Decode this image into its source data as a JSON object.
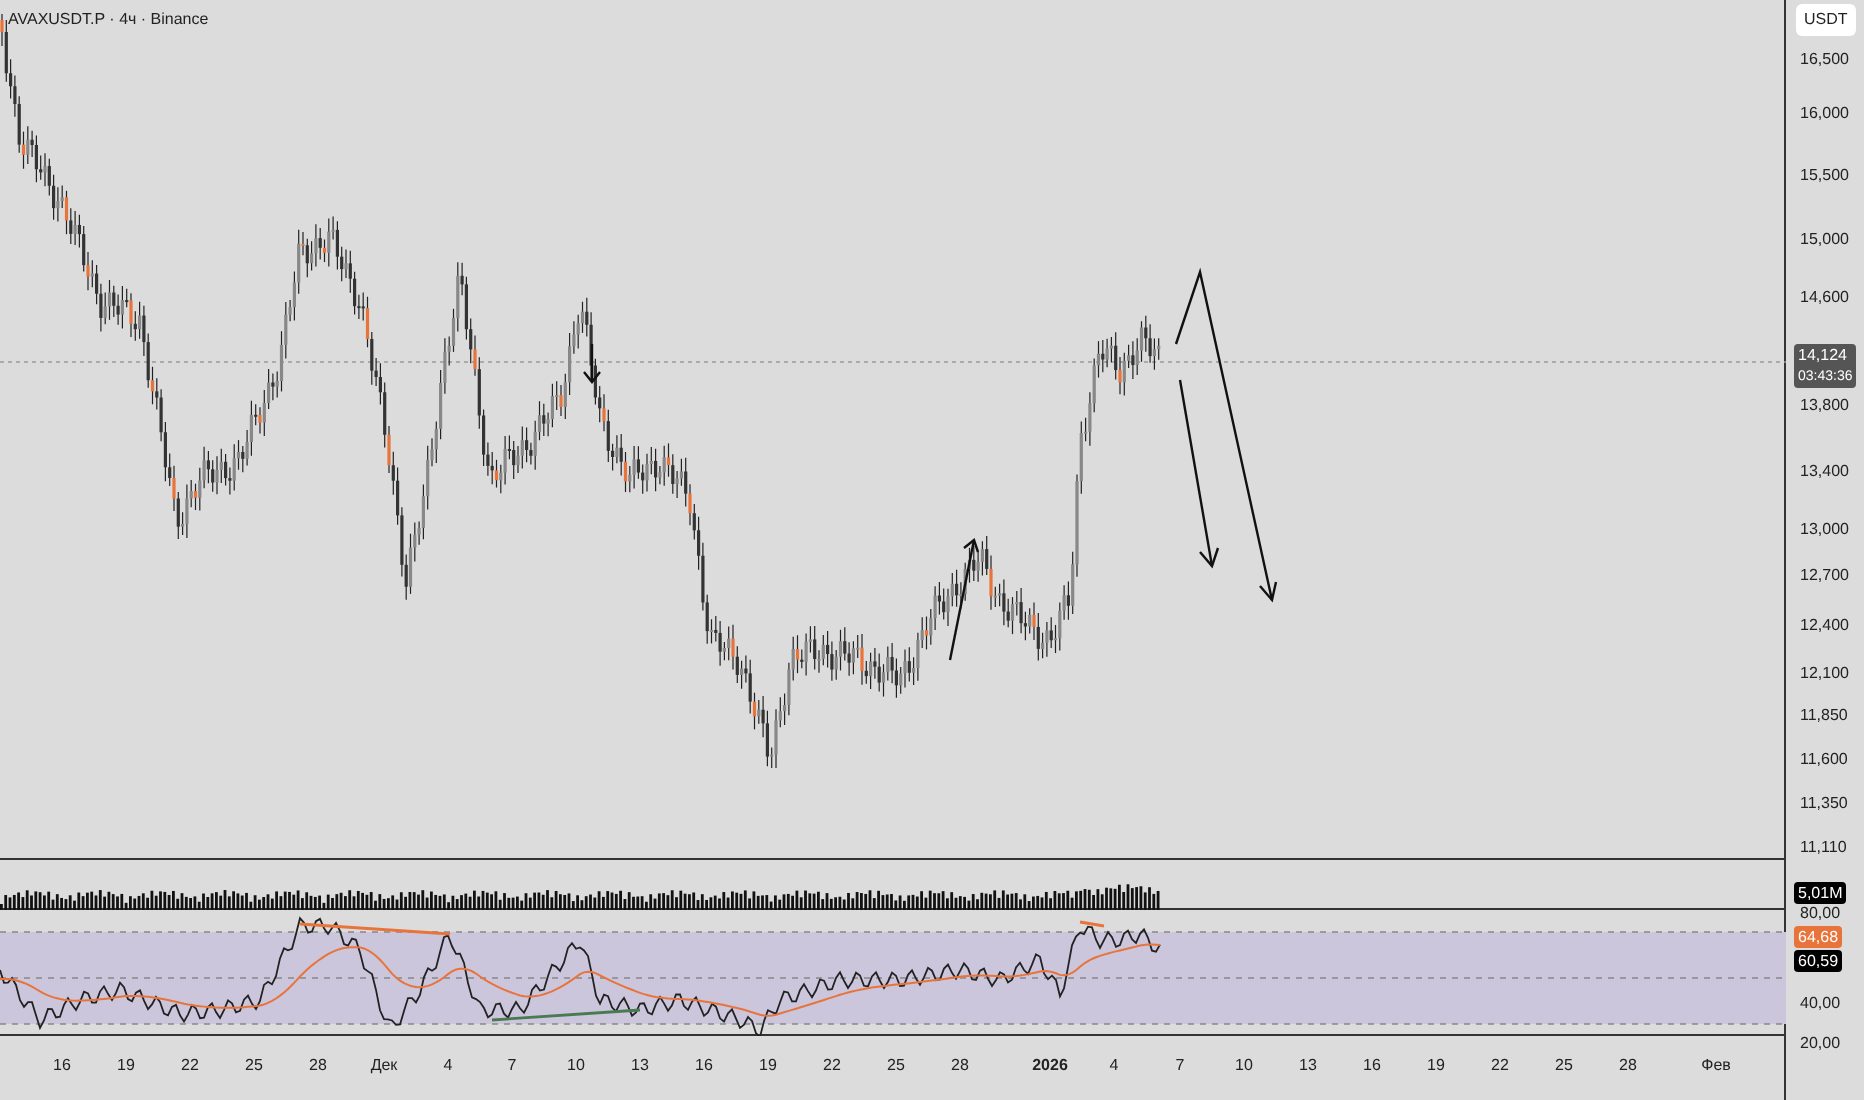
{
  "symbol_title": "AVAXUSDT.P · 4ч · Binance",
  "currency": "USDT",
  "price_axis": [
    "16,500",
    "16,000",
    "15,500",
    "15,000",
    "14,600",
    "13,800",
    "13,400",
    "13,000",
    "12,700",
    "12,400",
    "12,100",
    "11,850",
    "11,600",
    "11,350",
    "11,110"
  ],
  "last_price": {
    "price": "14,124",
    "countdown": "03:43:36"
  },
  "volume_label": "5,01M",
  "rsi_axis": [
    "80,00",
    "40,00",
    "20,00"
  ],
  "rsi_ma_value": "64,68",
  "rsi_value": "60,59",
  "time_axis": [
    {
      "label": "16",
      "bold": false
    },
    {
      "label": "19",
      "bold": false
    },
    {
      "label": "22",
      "bold": false
    },
    {
      "label": "25",
      "bold": false
    },
    {
      "label": "28",
      "bold": false
    },
    {
      "label": "Дек",
      "bold": false
    },
    {
      "label": "4",
      "bold": false
    },
    {
      "label": "7",
      "bold": false
    },
    {
      "label": "10",
      "bold": false
    },
    {
      "label": "13",
      "bold": false
    },
    {
      "label": "16",
      "bold": false
    },
    {
      "label": "19",
      "bold": false
    },
    {
      "label": "22",
      "bold": false
    },
    {
      "label": "25",
      "bold": false
    },
    {
      "label": "28",
      "bold": false
    },
    {
      "label": "2026",
      "bold": true
    },
    {
      "label": "4",
      "bold": false
    },
    {
      "label": "7",
      "bold": false
    },
    {
      "label": "10",
      "bold": false
    },
    {
      "label": "13",
      "bold": false
    },
    {
      "label": "16",
      "bold": false
    },
    {
      "label": "19",
      "bold": false
    },
    {
      "label": "22",
      "bold": false
    },
    {
      "label": "25",
      "bold": false
    },
    {
      "label": "28",
      "bold": false
    },
    {
      "label": "Фев",
      "bold": false
    }
  ]
}
